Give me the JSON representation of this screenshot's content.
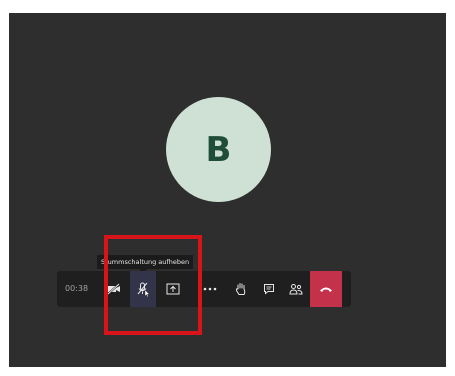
{
  "call": {
    "avatar_initial": "B",
    "timer": "00:38",
    "tooltip": "Stummschaltung aufheben"
  },
  "toolbar": {
    "buttons": [
      {
        "name": "camera-off-button",
        "icon": "camera-off-icon"
      },
      {
        "name": "unmute-button",
        "icon": "mic-off-icon",
        "active": true
      },
      {
        "name": "share-screen-button",
        "icon": "share-screen-icon"
      },
      {
        "name": "more-options-button",
        "icon": "more-icon"
      },
      {
        "name": "raise-hand-button",
        "icon": "hand-icon"
      },
      {
        "name": "chat-button",
        "icon": "chat-icon"
      },
      {
        "name": "participants-button",
        "icon": "people-icon"
      },
      {
        "name": "hang-up-button",
        "icon": "phone-hangup-icon"
      }
    ]
  },
  "colors": {
    "background": "#2e2e2e",
    "avatar_bg": "#cfe1d5",
    "avatar_text": "#1f4d36",
    "toolbar_bg": "#1f1f1f",
    "hangup": "#c4314b",
    "highlight_box": "#d8141b"
  }
}
